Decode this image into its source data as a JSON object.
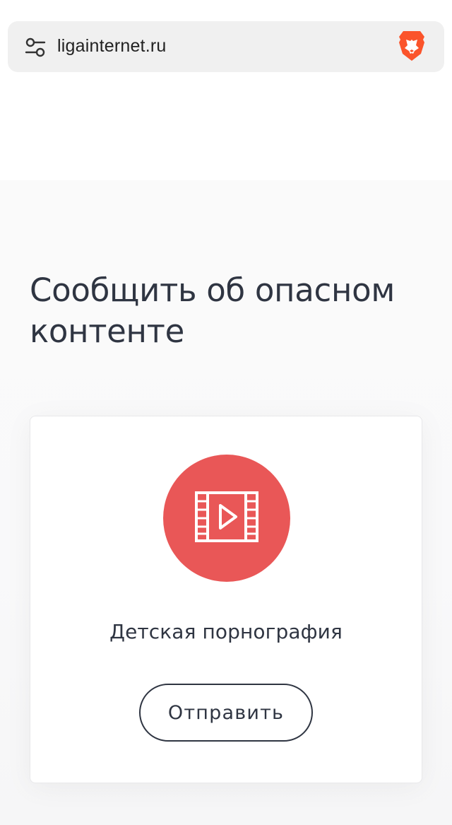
{
  "browser": {
    "url": "ligainternet.ru",
    "site_settings_icon": "tune-sliders-icon",
    "brave_icon": "brave-lion-icon"
  },
  "main": {
    "title": "Сообщить об опасном контенте",
    "card": {
      "icon": "video-film-play-icon",
      "icon_bg_color": "#e95757",
      "label": "Детская порнография",
      "button_label": "Отправить"
    }
  },
  "colors": {
    "text_dark": "#2f3542",
    "accent_red": "#e95757",
    "brave_orange": "#fb542b"
  }
}
